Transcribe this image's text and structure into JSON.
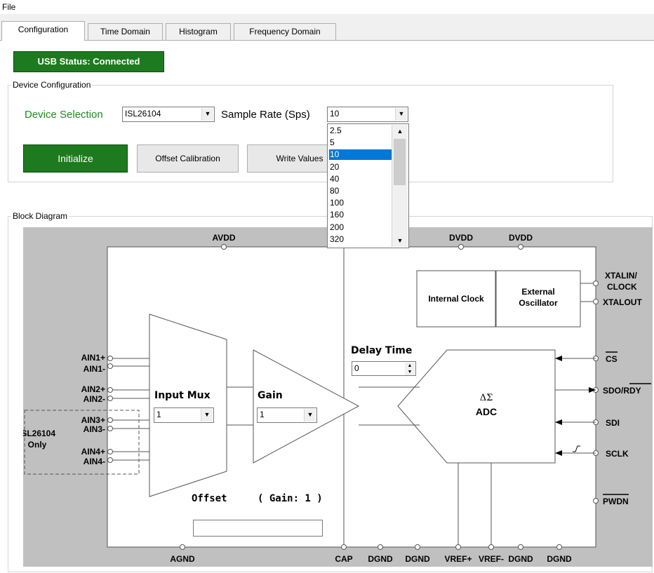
{
  "menu": {
    "file": "File"
  },
  "tabs": [
    "Configuration",
    "Time Domain",
    "Histogram",
    "Frequency Domain"
  ],
  "usb_status": "USB Status: Connected",
  "device_config": {
    "group_label": "Device Configuration",
    "device_selection_label": "Device Selection",
    "device_value": "ISL26104",
    "sample_rate_label": "Sample Rate (Sps)",
    "sample_rate_value": "10",
    "sample_rate_options": [
      "2.5",
      "5",
      "10",
      "20",
      "40",
      "80",
      "100",
      "160",
      "200",
      "320"
    ],
    "initialize": "Initialize",
    "offset_calibration": "Offset Calibration",
    "write_values": "Write Values"
  },
  "block_diagram": {
    "group_label": "Block Diagram",
    "pins_top": {
      "avdd": "AVDD",
      "dvdd1": "DVDD",
      "dvdd2": "DVDD"
    },
    "pins_left": {
      "ain1p": "AIN1+",
      "ain1m": "AIN1-",
      "ain2p": "AIN2+",
      "ain2m": "AIN2-",
      "ain3p": "AIN3+",
      "ain3m": "AIN3-",
      "ain4p": "AIN4+",
      "ain4m": "AIN4-"
    },
    "isl_only_line1": "ISL26104",
    "isl_only_line2": "Only",
    "pins_right": {
      "xtalin": "XTALIN/",
      "clock": "CLOCK",
      "xtalout": "XTALOUT",
      "cs": "CS",
      "sdo": "SDO/RDY",
      "sdi": "SDI",
      "sclk": "SCLK",
      "pwdn": "PWDN"
    },
    "pins_bottom": {
      "agnd": "AGND",
      "cap": "CAP",
      "dgnd1": "DGND",
      "dgnd2": "DGND",
      "vrefp": "VREF+",
      "vrefm": "VREF-",
      "dgnd3": "DGND",
      "dgnd4": "DGND"
    },
    "internal_clock": "Internal Clock",
    "external_oscillator_line1": "External",
    "external_oscillator_line2": "Oscillator",
    "delay_time_label": "Delay Time",
    "delay_time_value": "0",
    "input_mux_label": "Input Mux",
    "input_mux_value": "1",
    "gain_label": "Gain",
    "gain_value": "1",
    "adc_symbol": "ΔΣ",
    "adc_label": "ADC",
    "offset_label": "Offset",
    "gain_info": "( Gain: 1 )",
    "offset_value": ""
  },
  "colors": {
    "green_button": "#1e7a1e",
    "green_text": "#1e8a1e",
    "selection": "#0078d7",
    "diagram_bg": "#c0c0c0"
  }
}
